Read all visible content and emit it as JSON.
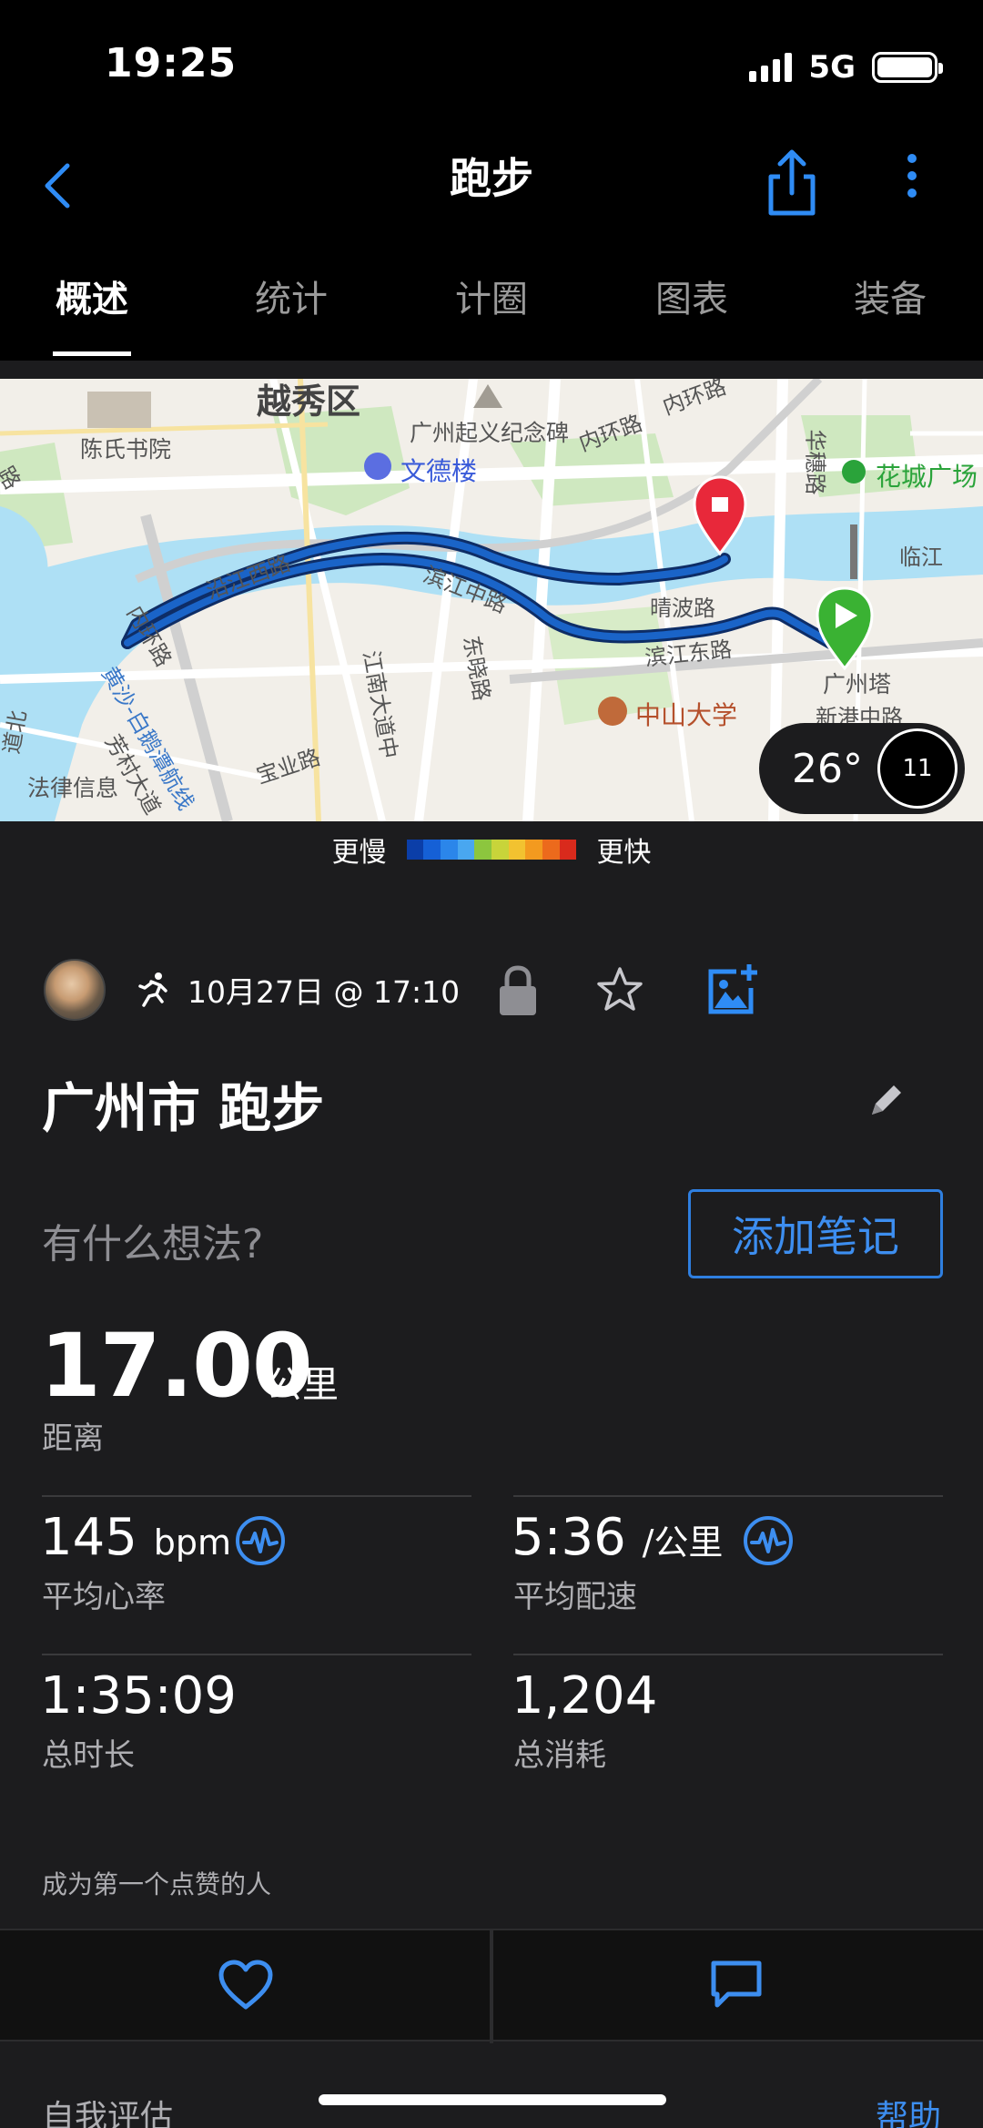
{
  "status_bar": {
    "time": "19:25",
    "network": "5G"
  },
  "nav": {
    "title": "跑步"
  },
  "tabs": [
    {
      "label": "概述",
      "active": true
    },
    {
      "label": "统计",
      "active": false
    },
    {
      "label": "计圈",
      "active": false
    },
    {
      "label": "图表",
      "active": false
    },
    {
      "label": "装备",
      "active": false
    }
  ],
  "map": {
    "labels": {
      "yuexiu": "越秀区",
      "chen_shuyuan": "陈氏书院",
      "qiyi": "广州起义纪念碑",
      "wende": "文德楼",
      "neihuan1": "内环路",
      "neihuan2": "内环路",
      "neihuan3": "内环路",
      "huasui": "华穗路",
      "huacheng": "花城广场",
      "linjiang": "临江",
      "yanjiang": "沿江西路",
      "binjiang_zhong": "滨江中路",
      "qingbo": "晴波路",
      "binjiang_dong": "滨江东路",
      "dongxiao": "东晓路",
      "jiangnan": "江南大道中",
      "zhongshan": "中山大学",
      "guangzhou_ta": "广州塔",
      "xingang": "新港中路",
      "baoye": "宝业路",
      "huangsha": "黄沙-白鹅潭航线",
      "falv": "法律信息",
      "fangcun": "芳村大道",
      "daobei": "道北",
      "lu_left": "路"
    },
    "weather": {
      "temperature": "26°",
      "wind": "11"
    }
  },
  "pace_legend": {
    "slower": "更慢",
    "faster": "更快",
    "colors": [
      "#0b3ea8",
      "#1560d6",
      "#2b86ea",
      "#49a7f0",
      "#8cc63e",
      "#c8d43a",
      "#f2c230",
      "#f39a1f",
      "#ec6a1c",
      "#d92a1c"
    ]
  },
  "activity": {
    "date": "10月27日 @ 17:10",
    "title": "广州市 跑步",
    "notes_prompt": "有什么想法?",
    "add_note": "添加笔记"
  },
  "stats": {
    "distance": {
      "value": "17.00",
      "unit": "公里",
      "label": "距离"
    },
    "heart_rate": {
      "value": "145",
      "unit": "bpm",
      "label": "平均心率"
    },
    "pace": {
      "value": "5:36",
      "unit": "/公里",
      "label": "平均配速"
    },
    "duration": {
      "value": "1:35:09",
      "label": "总时长"
    },
    "calories": {
      "value": "1,204",
      "label": "总消耗"
    }
  },
  "social": {
    "kudos": "成为第一个点赞的人"
  },
  "footer": {
    "self_eval": "自我评估",
    "help": "帮助"
  },
  "colors": {
    "accent": "#3d8ef0",
    "background": "#1c1c1e",
    "route": "#1a64c8",
    "end_marker": "#e8283a",
    "start_marker": "#3ab233"
  }
}
